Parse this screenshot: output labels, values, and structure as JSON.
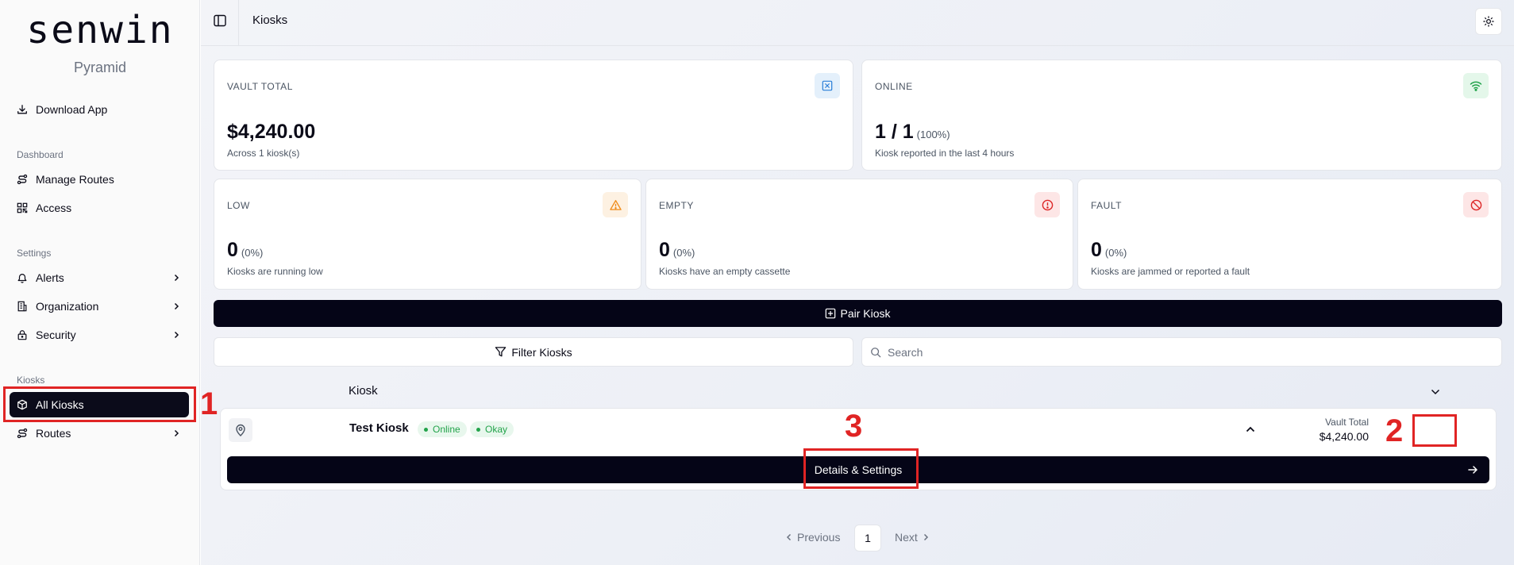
{
  "brand": {
    "logo": "senwin",
    "org": "Pyramid"
  },
  "sidebar": {
    "download_app": "Download App",
    "sections": {
      "dashboard": "Dashboard",
      "settings": "Settings",
      "kiosks": "Kiosks"
    },
    "items": {
      "manage_routes": "Manage Routes",
      "access": "Access",
      "alerts": "Alerts",
      "organization": "Organization",
      "security": "Security",
      "all_kiosks": "All Kiosks",
      "routes": "Routes"
    }
  },
  "header": {
    "title": "Kiosks"
  },
  "stats": {
    "vault_total": {
      "label": "VAULT TOTAL",
      "value": "$4,240.00",
      "sub": "Across 1 kiosk(s)",
      "badge_color": "#2b7fd8"
    },
    "online": {
      "label": "ONLINE",
      "value": "1 / 1",
      "pct": "(100%)",
      "sub": "Kiosk reported in the last 4 hours",
      "badge_color": "#22a34a"
    },
    "low": {
      "label": "LOW",
      "value": "0",
      "pct": "(0%)",
      "sub": "Kiosks are running low",
      "badge_color": "#f08c1a"
    },
    "empty": {
      "label": "EMPTY",
      "value": "0",
      "pct": "(0%)",
      "sub": "Kiosks have an empty cassette",
      "badge_color": "#dc2626"
    },
    "fault": {
      "label": "FAULT",
      "value": "0",
      "pct": "(0%)",
      "sub": "Kiosks are jammed or reported a fault",
      "badge_color": "#dc2626"
    }
  },
  "actions": {
    "pair_kiosk": "Pair Kiosk",
    "filter_kiosks": "Filter Kiosks",
    "search_placeholder": "Search"
  },
  "table": {
    "column": "Kiosk"
  },
  "kiosks": [
    {
      "name": "Test Kiosk",
      "status": "Online",
      "condition": "Okay",
      "vault_label": "Vault Total",
      "vault_value": "$4,240.00",
      "details_button": "Details & Settings"
    }
  ],
  "pagination": {
    "previous": "Previous",
    "page": "1",
    "next": "Next"
  },
  "annotations": {
    "one": "1",
    "two": "2",
    "three": "3",
    "color": "#e02424"
  }
}
